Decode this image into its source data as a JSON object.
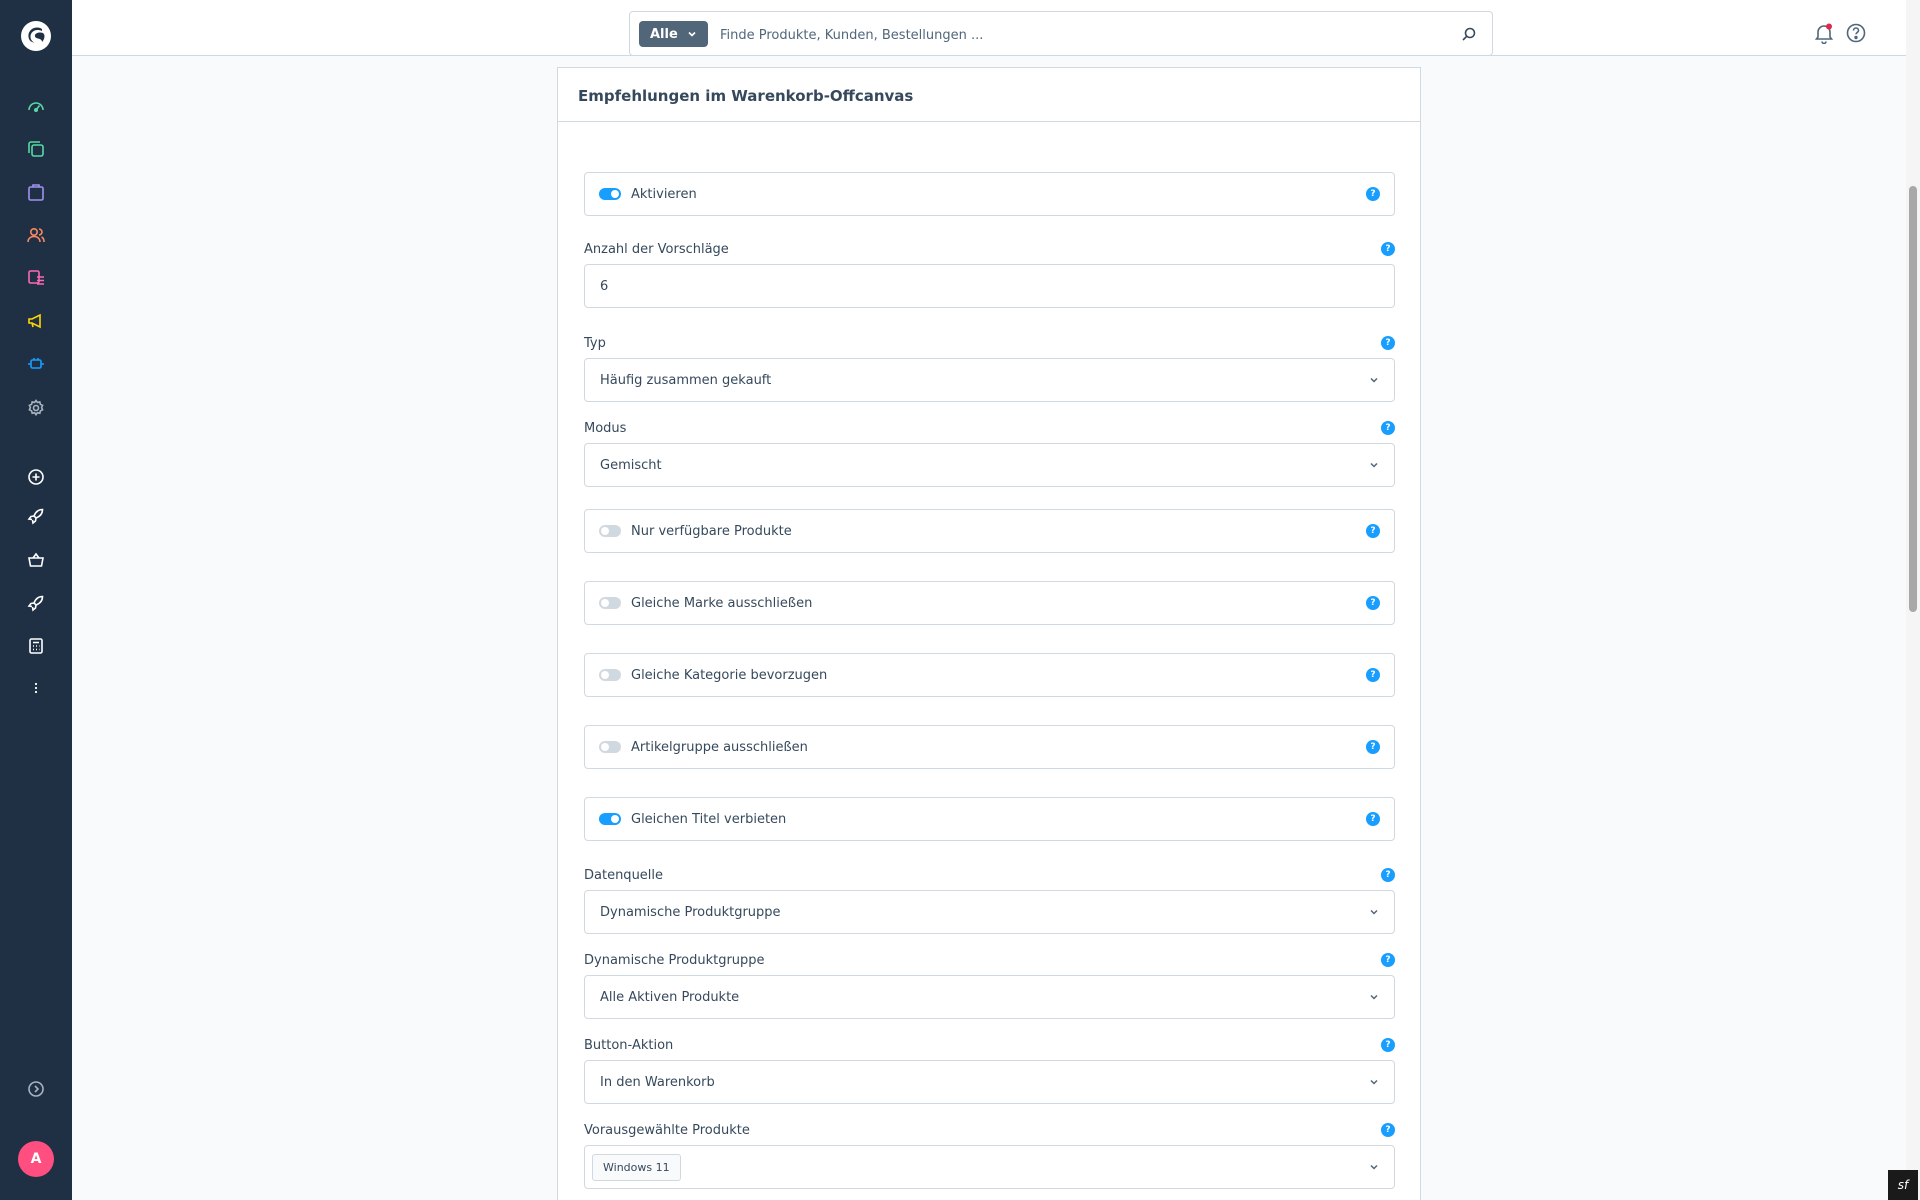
{
  "sidebar": {
    "items": [
      {
        "icon": "dashboard-icon",
        "color": "#57d9a3"
      },
      {
        "icon": "catalog-icon",
        "color": "#57d9a3"
      },
      {
        "icon": "orders-icon",
        "color": "#a092f0"
      },
      {
        "icon": "customers-icon",
        "color": "#f88962"
      },
      {
        "icon": "content-icon",
        "color": "#ff68b4"
      },
      {
        "icon": "marketing-icon",
        "color": "#ffd700"
      },
      {
        "icon": "extensions-icon",
        "color": "#189eff"
      },
      {
        "icon": "settings-icon",
        "color": "#a8b3bf"
      },
      {
        "icon": "add-icon",
        "color": "#ffffff"
      },
      {
        "icon": "rocket-icon",
        "color": "#ffffff"
      },
      {
        "icon": "basket-icon",
        "color": "#ffffff"
      },
      {
        "icon": "rocket-icon",
        "color": "#ffffff"
      },
      {
        "icon": "calculator-icon",
        "color": "#ffffff"
      },
      {
        "icon": "more-icon",
        "color": "#ffffff"
      },
      {
        "icon": "collapse-icon",
        "color": "#a8b3bf"
      }
    ],
    "avatar_initial": "A"
  },
  "search": {
    "type_label": "Alle",
    "placeholder": "Finde Produkte, Kunden, Bestellungen ..."
  },
  "card": {
    "title": "Empfehlungen im Warenkorb-Offcanvas",
    "help_glyph": "?",
    "toggles": {
      "activate": {
        "label": "Aktivieren",
        "on": true
      },
      "only_available": {
        "label": "Nur verfügbare Produkte",
        "on": false
      },
      "exclude_brand": {
        "label": "Gleiche Marke ausschließen",
        "on": false
      },
      "prefer_category": {
        "label": "Gleiche Kategorie bevorzugen",
        "on": false
      },
      "exclude_group": {
        "label": "Artikelgruppe ausschließen",
        "on": false
      },
      "forbid_title": {
        "label": "Gleichen Titel verbieten",
        "on": true
      }
    },
    "fields": {
      "count": {
        "label": "Anzahl der Vorschläge",
        "value": "6"
      },
      "type": {
        "label": "Typ",
        "value": "Häufig zusammen gekauft"
      },
      "mode": {
        "label": "Modus",
        "value": "Gemischt"
      },
      "source": {
        "label": "Datenquelle",
        "value": "Dynamische Produktgruppe"
      },
      "stream": {
        "label": "Dynamische Produktgruppe",
        "value": "Alle Aktiven Produkte"
      },
      "button": {
        "label": "Button-Aktion",
        "value": "In den Warenkorb"
      },
      "preselected": {
        "label": "Vorausgewählte Produkte",
        "chip": "Windows 11"
      }
    }
  },
  "colors": {
    "accent": "#189eff",
    "sidebar": "#1f3045",
    "notification_dot": "#de294c"
  }
}
